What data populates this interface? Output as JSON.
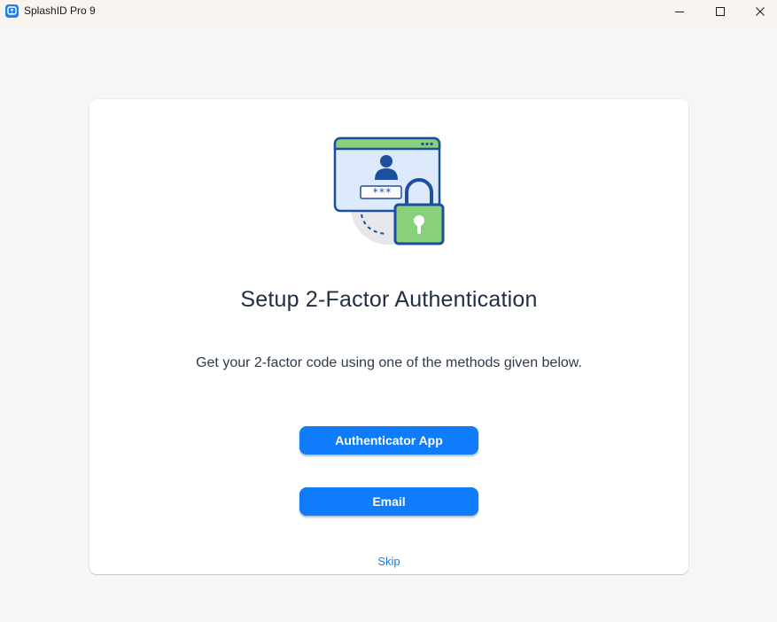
{
  "window": {
    "title": "SplashID Pro 9",
    "app_icon": "splashid-logo-icon",
    "controls": {
      "minimize_icon": "minimize-icon",
      "maximize_icon": "maximize-icon",
      "close_icon": "close-icon"
    }
  },
  "illustration": {
    "icon": "browser-login-lock-icon",
    "password_mask": "***"
  },
  "main": {
    "heading": "Setup 2-Factor Authentication",
    "description": "Get your 2-factor code using one of the methods given below.",
    "buttons": {
      "authenticator_app": "Authenticator App",
      "email": "Email"
    },
    "skip_label": "Skip"
  },
  "colors": {
    "primary_button": "#0f7cfb",
    "link": "#1a78e6",
    "heading": "#1f2d45",
    "illustration_green": "#88d17a",
    "illustration_navy": "#1c4fa0"
  }
}
